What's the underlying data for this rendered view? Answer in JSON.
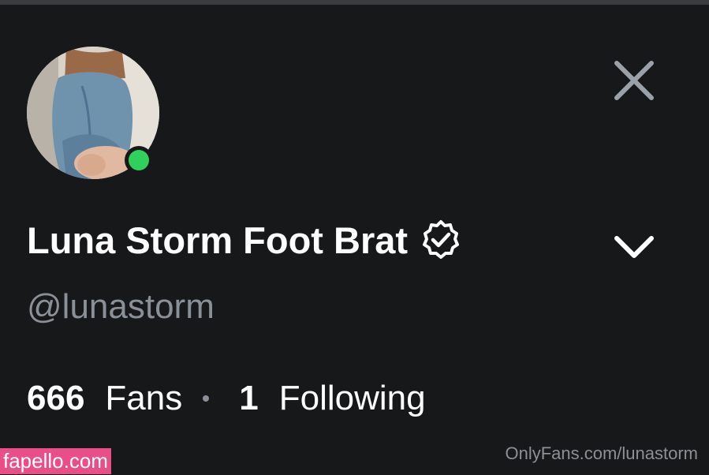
{
  "profile": {
    "display_name": "Luna Storm Foot Brat",
    "handle": "@lunastorm",
    "online": true,
    "verified": true
  },
  "stats": {
    "fans_count": "666",
    "fans_label": "Fans",
    "following_count": "1",
    "following_label": "Following"
  },
  "icons": {
    "close": "close-icon",
    "expand": "chevron-down-icon",
    "verified": "verified-badge-icon"
  },
  "colors": {
    "background": "#17181a",
    "name_text": "#ffffff",
    "handle_text": "#8a9097",
    "online_indicator": "#2fd05c",
    "watermark_badge": "#e94e88"
  },
  "watermarks": {
    "left": "fapello.com",
    "right": "OnlyFans.com/lunastorm"
  }
}
